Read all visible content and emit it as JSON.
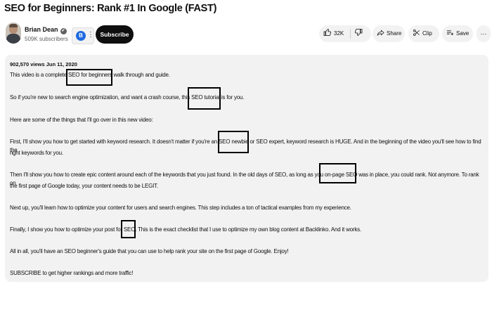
{
  "video": {
    "title": "SEO for Beginners: Rank #1 In Google (FAST)"
  },
  "channel": {
    "name": "Brian Dean",
    "verified_glyph": "✔",
    "subscribers": "509K subscribers",
    "subscribe_label": "Subscribe",
    "notif_logo_letter": "B",
    "notif_dots": "⋮"
  },
  "actions": {
    "likes": "32K",
    "like_icon": "thumbs-up-icon",
    "dislike_icon": "thumbs-down-icon",
    "share_label": "Share",
    "clip_label": "Clip",
    "save_label": "Save",
    "more_label": "···"
  },
  "description": {
    "meta": "902,570 views  Jun 11, 2020",
    "paragraphs": [
      "This video is a complete SEO for beginners walk through and guide.",
      "So if you're new to search engine optimization, and want a crash course, this SEO tutorial is for you.",
      "Here are some of the things that I'll go over in this new video:",
      "First, I'll show you how to get started with keyword research. It doesn't matter if you're an SEO newbie or SEO expert, keyword research is HUGE. And in the beginning of the video you'll see how to find the",
      "right keywords for you.",
      "Then I'll show you how to create epic content around each of the keywords that you just found. In the old days of SEO, as long as you on-page SEO was in place, you could rank. Not anymore. To rank on",
      "the first page of Google today, your content needs to be LEGIT.",
      "Next up, you'll learn how to optimize your content for users and search engines. This step includes a ton of tactical examples from my experience.",
      "Finally, I show you how to optimize your post for SEO. This is the exact checklist that I use to optimize my own blog content at Backlinko. And it works.",
      "All in all, you'll have an SEO beginner's guide that you can use to help rank your site on the first page of Google. Enjoy!",
      "SUBSCRIBE to get higher rankings and more traffic!"
    ]
  },
  "colors": {
    "background": "#ffffff",
    "panel": "#f2f2f2",
    "subscribe_bg": "#0f0f0f",
    "secondary_text": "#606060"
  }
}
